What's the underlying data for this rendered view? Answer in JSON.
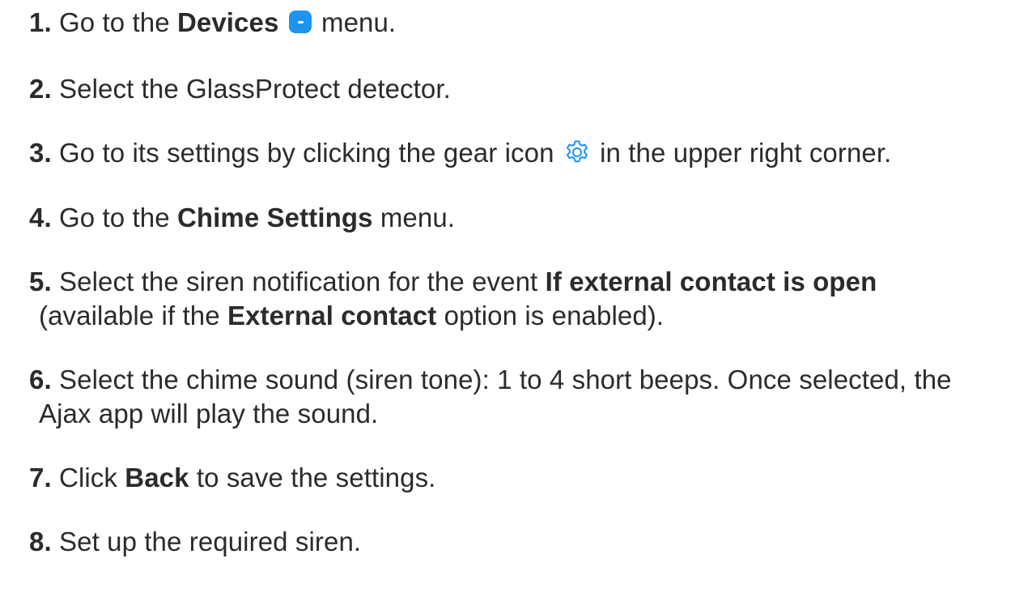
{
  "steps": [
    {
      "num": "1.",
      "parts": [
        "Go to the ",
        "Devices",
        " menu."
      ],
      "icon": "devices-icon"
    },
    {
      "num": "2.",
      "parts": [
        "Select the GlassProtect detector."
      ]
    },
    {
      "num": "3.",
      "parts": [
        "Go to its settings by clicking the gear icon ",
        " in the upper right corner."
      ],
      "icon": "gear-icon"
    },
    {
      "num": "4.",
      "parts": [
        "Go to the ",
        "Chime Settings",
        " menu."
      ]
    },
    {
      "num": "5.",
      "parts": [
        "Select the siren notification for the event ",
        "If external contact is open",
        "(available if the ",
        "External contact",
        " option is enabled)."
      ]
    },
    {
      "num": "6.",
      "parts": [
        "Select the chime sound (siren tone): 1 to 4 short beeps. Once selected, the",
        "Ajax app will play the sound."
      ]
    },
    {
      "num": "7.",
      "parts": [
        "Click ",
        "Back",
        " to save the settings."
      ]
    },
    {
      "num": "8.",
      "parts": [
        "Set up the required siren."
      ]
    }
  ],
  "colors": {
    "text": "#2b2b2b",
    "accent": "#1c94f0"
  }
}
